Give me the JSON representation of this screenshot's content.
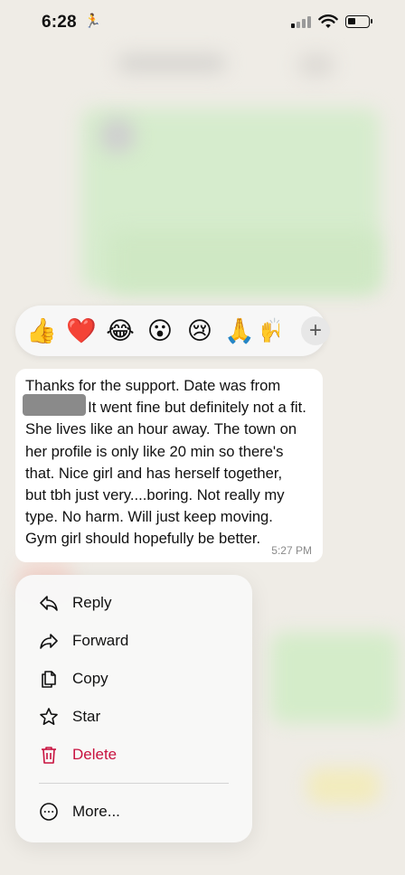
{
  "status_bar": {
    "time": "6:28"
  },
  "reactions": {
    "emojis": [
      "👍",
      "❤️",
      "😂",
      "😮",
      "😢",
      "🙏",
      "🙌"
    ],
    "selected_index": 1,
    "more_symbol": "+"
  },
  "message": {
    "text": "Thanks for the support. Date was from\n               It went fine but definitely not a fit.\nShe lives like an hour away. The town on\nher profile is only like 20 min so there's\nthat. Nice girl and has herself together,\nbut tbh just very....boring. Not really my\ntype. No harm. Will just keep moving.\nGym girl should hopefully be better.",
    "time": "5:27 PM"
  },
  "menu": {
    "reply": "Reply",
    "forward": "Forward",
    "copy": "Copy",
    "star": "Star",
    "delete": "Delete",
    "more": "More..."
  },
  "colors": {
    "delete": "#c8123f",
    "background": "#efece6",
    "bubble": "#ffffff"
  }
}
